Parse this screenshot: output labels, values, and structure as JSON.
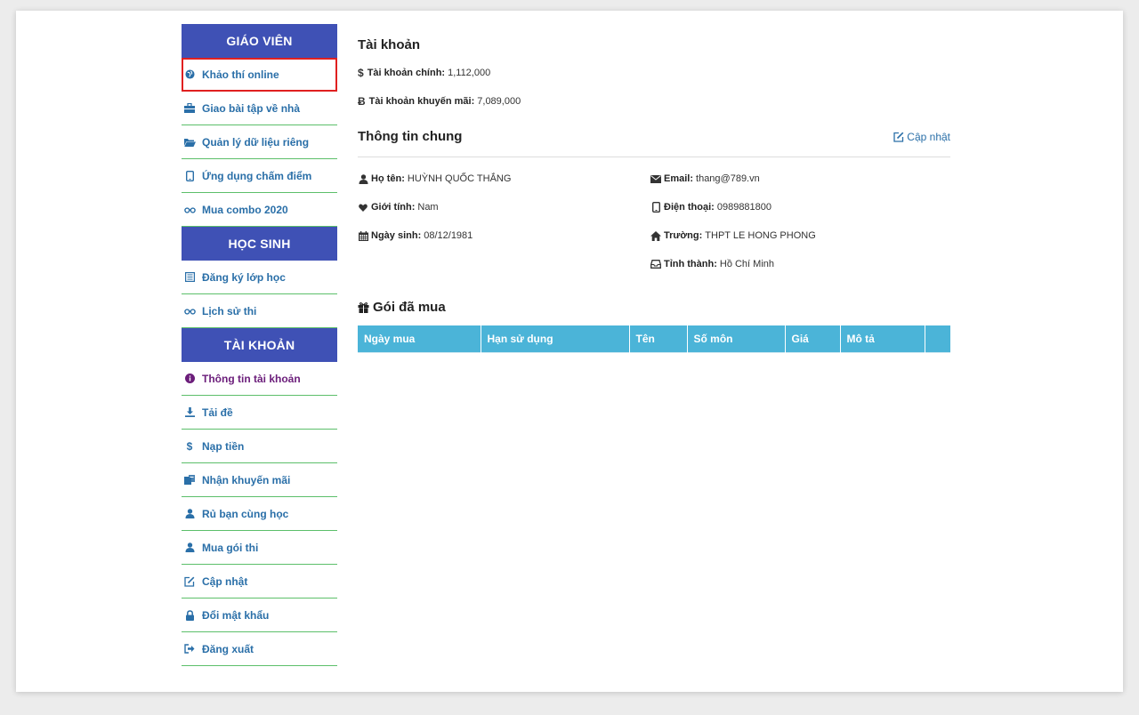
{
  "sidebar": {
    "teacher_header": "GIÁO VIÊN",
    "teacher_items": [
      {
        "label": "Khảo thí online",
        "icon": "globe-icon"
      },
      {
        "label": "Giao bài tập về nhà",
        "icon": "briefcase-icon"
      },
      {
        "label": "Quản lý dữ liệu riêng",
        "icon": "folder-icon"
      },
      {
        "label": "Ứng dụng chấm điểm",
        "icon": "mobile-icon"
      },
      {
        "label": "Mua combo 2020",
        "icon": "glasses-icon"
      }
    ],
    "student_header": "HỌC SINH",
    "student_items": [
      {
        "label": "Đăng ký lớp học",
        "icon": "list-icon"
      },
      {
        "label": "Lịch sử thi",
        "icon": "glasses-icon"
      }
    ],
    "account_header": "TÀI KHOẢN",
    "account_items": [
      {
        "label": "Thông tin tài khoản",
        "icon": "info-icon"
      },
      {
        "label": "Tải đề",
        "icon": "download-icon"
      },
      {
        "label": "Nạp tiền",
        "icon": "dollar-icon"
      },
      {
        "label": "Nhận khuyến mãi",
        "icon": "gift-coupon-icon"
      },
      {
        "label": "Rủ bạn cùng học",
        "icon": "user-icon"
      },
      {
        "label": "Mua gói thi",
        "icon": "user-icon"
      },
      {
        "label": "Cập nhật",
        "icon": "edit-icon"
      },
      {
        "label": "Đổi mật khẩu",
        "icon": "lock-icon"
      },
      {
        "label": "Đăng xuất",
        "icon": "logout-icon"
      }
    ]
  },
  "account": {
    "title": "Tài khoản",
    "main_label": "Tài khoản chính:",
    "main_value": "1,112,000",
    "promo_label": "Tài khoản khuyến mãi:",
    "promo_value": "7,089,000"
  },
  "general": {
    "title": "Thông tin chung",
    "update_link": "Cập nhật",
    "name_label": "Họ tên:",
    "name_value": "HUỲNH QUỐC THẮNG",
    "gender_label": "Giới tính:",
    "gender_value": "Nam",
    "dob_label": "Ngày sinh:",
    "dob_value": "08/12/1981",
    "email_label": "Email:",
    "email_value": "thang@789.vn",
    "phone_label": "Điện thoại:",
    "phone_value": "0989881800",
    "school_label": "Trường:",
    "school_value": "THPT LE HONG PHONG",
    "province_label": "Tỉnh thành:",
    "province_value": "Hồ Chí Minh"
  },
  "packages": {
    "title": "Gói đã mua",
    "columns": [
      "Ngày mua",
      "Hạn sử dụng",
      "Tên",
      "Số môn",
      "Giá",
      "Mô tả",
      ""
    ]
  },
  "colors": {
    "header_bg": "#3f51b5",
    "link": "#2a6fa8",
    "active": "#6b1d7a",
    "table_header": "#4bb4d8",
    "divider": "#5cbf6a"
  }
}
